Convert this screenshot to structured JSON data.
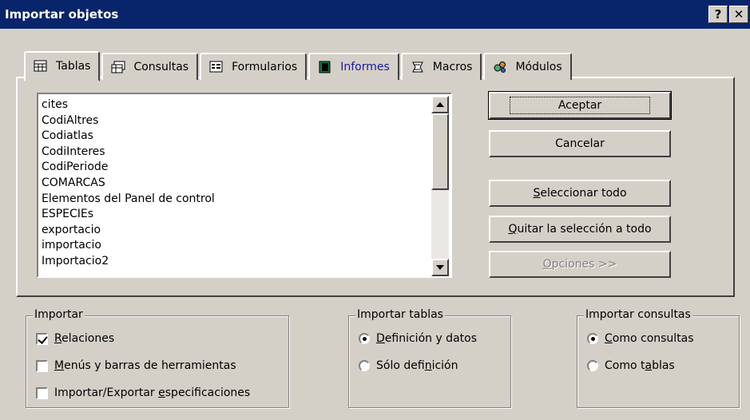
{
  "window": {
    "title": "Importar objetos",
    "help_label": "?",
    "close_label": "✕"
  },
  "tabs": [
    {
      "label": "Tablas",
      "icon": "table-icon",
      "active": true
    },
    {
      "label": "Consultas",
      "icon": "query-icon"
    },
    {
      "label": "Formularios",
      "icon": "form-icon"
    },
    {
      "label": "Informes",
      "icon": "report-icon"
    },
    {
      "label": "Macros",
      "icon": "macro-icon"
    },
    {
      "label": "Módulos",
      "icon": "module-icon"
    }
  ],
  "list": {
    "items": [
      "cites",
      "CodiAltres",
      "Codiatlas",
      "CodiInteres",
      "CodiPeriode",
      "COMARCAS",
      "Elementos del Panel de control",
      "ESPECIEs",
      "exportacio",
      "importacio",
      "Importacio2"
    ]
  },
  "buttons": {
    "accept": "Aceptar",
    "cancel": "Cancelar",
    "select_all_u": "S",
    "select_all_rest": "eleccionar todo",
    "deselect_u": "Q",
    "deselect_rest": "uitar la selección a todo",
    "options_u": "O",
    "options_rest": "pciones >>"
  },
  "import_group": {
    "legend": "Importar",
    "relations_u": "R",
    "relations_rest": "elaciones",
    "menus_u": "M",
    "menus_rest": "enús y barras de herramientas",
    "specs_pre": "Importar/Exportar ",
    "specs_u": "e",
    "specs_rest": "specificaciones"
  },
  "tables_group": {
    "legend": "Importar tablas",
    "def_data_u": "D",
    "def_data_rest": "efinición y datos",
    "only_def_pre": "Sólo defi",
    "only_def_u": "n",
    "only_def_rest": "ición"
  },
  "queries_group": {
    "legend": "Importar consultas",
    "as_queries_u": "C",
    "as_queries_rest": "omo consultas",
    "as_tables_pre": "Como t",
    "as_tables_u": "a",
    "as_tables_rest": "blas"
  }
}
